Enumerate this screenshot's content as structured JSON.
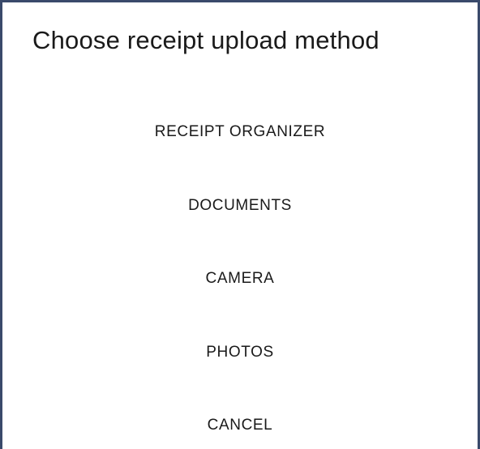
{
  "dialog": {
    "title": "Choose receipt upload method",
    "options": [
      {
        "label": "RECEIPT ORGANIZER"
      },
      {
        "label": "DOCUMENTS"
      },
      {
        "label": "CAMERA"
      },
      {
        "label": "PHOTOS"
      },
      {
        "label": "CANCEL"
      }
    ]
  },
  "colors": {
    "border": "#3a4a6b",
    "text": "#1a1a1a",
    "background": "#ffffff"
  }
}
